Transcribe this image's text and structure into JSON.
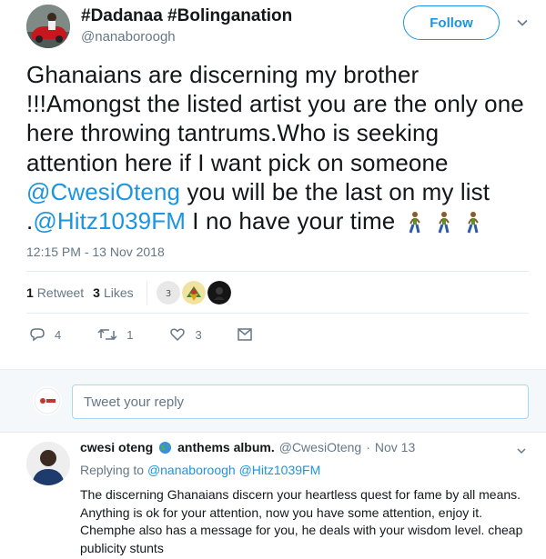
{
  "author": {
    "display_name": "#Dadanaa #Bolinganation",
    "handle": "@nanaboroogh",
    "follow_label": "Follow"
  },
  "tweet": {
    "text_1": "Ghanaians are discerning my brother !!!Amongst the listed artist you are the only one here throwing tantrums.Who is seeking attention here if I want pick on someone ",
    "mention_1": "@CwesiOteng",
    "text_2": " you will be the last on my list .",
    "mention_2": "@Hitz1039FM",
    "text_3": "  I no have your time",
    "timestamp": "12:15 PM - 13 Nov 2018"
  },
  "stats": {
    "retweets_count": "1",
    "retweets_label": "Retweet",
    "likes_count": "3",
    "likes_label": "Likes"
  },
  "actions": {
    "replies": "4",
    "retweets": "1",
    "likes": "3"
  },
  "reply_box": {
    "placeholder": "Tweet your reply"
  },
  "reply": {
    "name": "cwesi oteng",
    "name_suffix": "anthems album.",
    "handle": "@CwesiOteng",
    "separator": "·",
    "date": "Nov 13",
    "replying_prefix": "Replying to ",
    "replying_to_1": "@nanaboroogh",
    "replying_to_2": "@Hitz1039FM",
    "body": "The discerning Ghanaians discern your heartless quest for fame by all means. Anything is ok for your attention, now you have some attention, enjoy it. Chemphe also has a message for you, he deals with your wisdom level. cheap publicity stunts"
  },
  "colors": {
    "accent": "#1b95e0",
    "muted": "#657786",
    "text": "#14171a",
    "border": "#e6ecf0"
  },
  "icons": [
    "caret-down-icon",
    "reply-icon",
    "retweet-icon",
    "heart-icon",
    "message-icon",
    "globe-emoji",
    "walking-person-emoji"
  ]
}
